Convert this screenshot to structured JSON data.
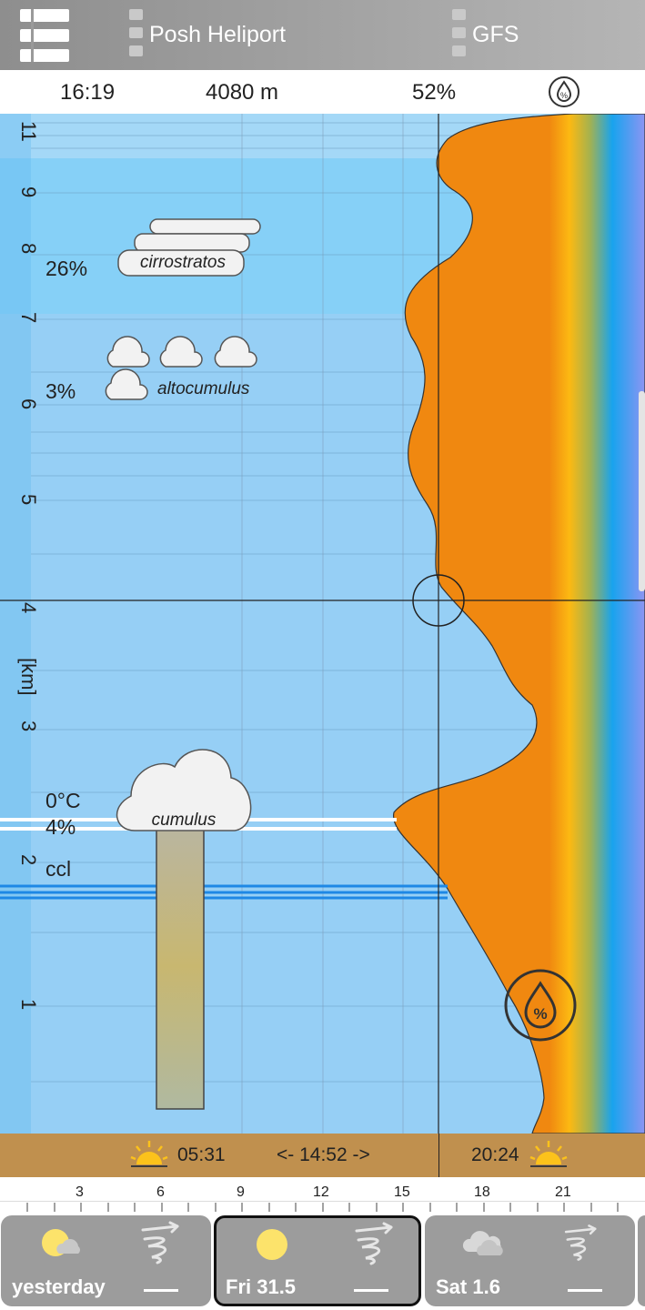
{
  "header": {
    "location": "Posh Heliport",
    "model": "GFS"
  },
  "info": {
    "time": "16:19",
    "altitude": "4080 m",
    "humidity": "52%"
  },
  "chart": {
    "axis_unit": "[km]",
    "y_ticks": [
      "1",
      "2",
      "3",
      "4",
      "5",
      "6",
      "7",
      "8",
      "9",
      "11"
    ],
    "clouds": [
      {
        "name": "cirrostratos",
        "percent": "26%"
      },
      {
        "name": "altocumulus",
        "percent": "3%"
      },
      {
        "name": "cumulus",
        "percent": "4%"
      }
    ],
    "freezing_label": "0°C",
    "ccl_label": "ccl"
  },
  "sun": {
    "sunrise": "05:31",
    "daylength": "<- 14:52 ->",
    "sunset": "20:24"
  },
  "time_axis": [
    "3",
    "6",
    "9",
    "12",
    "15",
    "18",
    "21"
  ],
  "days": [
    {
      "label": "yesterday"
    },
    {
      "label": "Fri 31.5"
    },
    {
      "label": "Sat 1.6"
    }
  ],
  "colors": {
    "sky": "#96cff5",
    "humidity_orange": "#f39a12",
    "humidity_blue": "#1aa2ef",
    "ccl_line": "#1e88e5",
    "sun_bar": "#c0904e"
  }
}
